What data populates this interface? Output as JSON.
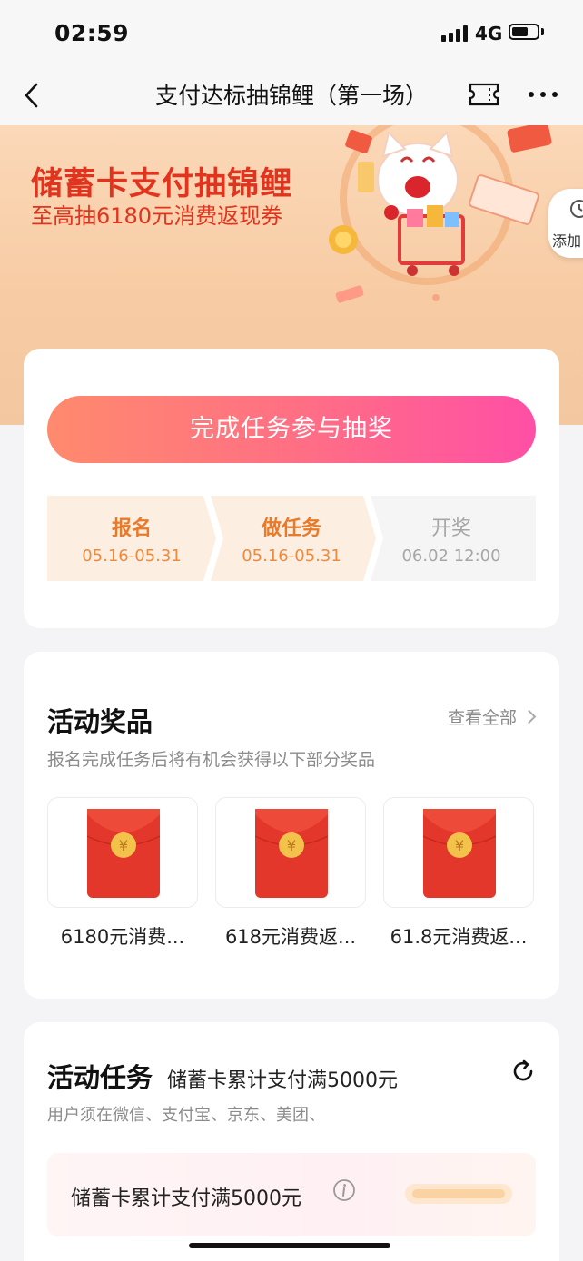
{
  "status_bar": {
    "time": "02:59",
    "network": "4G",
    "icons": [
      "signal-icon",
      "battery-icon"
    ]
  },
  "nav": {
    "title": "支付达标抽锦鲤（第一场）",
    "icons": [
      "back-icon",
      "ticket-icon",
      "more-icon"
    ]
  },
  "banner": {
    "title": "储蓄卡支付抽锦鲤",
    "subtitle": "至高抽6180元消费返现券",
    "add_label": "添加"
  },
  "lottery": {
    "cta_label": "完成任务参与抽奖",
    "steps": [
      {
        "label": "报名",
        "date": "05.16-05.31",
        "state": "active"
      },
      {
        "label": "做任务",
        "date": "05.16-05.31",
        "state": "active"
      },
      {
        "label": "开奖",
        "date": "06.02 12:00",
        "state": "pending"
      }
    ]
  },
  "prizes": {
    "title": "活动奖品",
    "view_all": "查看全部",
    "subtitle": "报名完成任务后将有机会获得以下部分奖品",
    "items": [
      {
        "name": "6180元消费..."
      },
      {
        "name": "618元消费返..."
      },
      {
        "name": "61.8元消费返..."
      }
    ]
  },
  "tasks": {
    "title": "活动任务",
    "subtitle": "储蓄卡累计支付满5000元",
    "description": "用户须在微信、支付宝、京东、美团、",
    "row_label": "储蓄卡累计支付满5000元"
  },
  "colors": {
    "accent_red": "#e2331e",
    "cta_start": "#ff8a6d",
    "cta_end": "#ff4fa6",
    "step_active": "#e97a2a",
    "envelope_red": "#e2372a",
    "coin_gold": "#f3c24a"
  }
}
